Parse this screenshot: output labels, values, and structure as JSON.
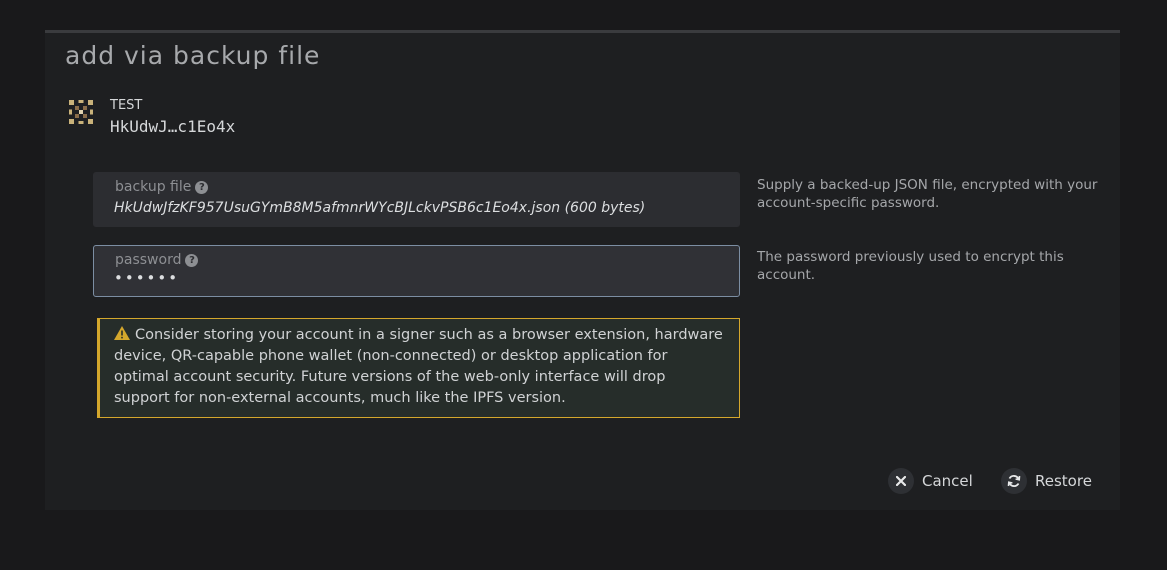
{
  "modal": {
    "title": "add via backup file"
  },
  "account": {
    "name": "TEST",
    "address": "HkUdwJ…c1Eo4x",
    "identicon": "identicon-icon"
  },
  "backup_file": {
    "label": "backup file",
    "value": "HkUdwJfzKF957UsuGYmB8M5afmnrWYcBJLckvPSB6c1Eo4x.json (600 bytes)",
    "help": "Supply a backed-up JSON file, encrypted with your account-specific password.",
    "help_icon": "question-circle-icon"
  },
  "password": {
    "label": "password",
    "value": "••••••",
    "help": "The password previously used to encrypt this account.",
    "help_icon": "question-circle-icon"
  },
  "warning": {
    "icon": "warning-triangle-icon",
    "text": "Consider storing your account in a signer such as a browser extension, hardware device, QR-capable phone wallet (non-connected) or desktop application for optimal account security. Future versions of the web-only interface will drop support for non-external accounts, much like the IPFS version.",
    "color": "#d4a72c"
  },
  "buttons": {
    "cancel_label": "Cancel",
    "cancel_icon": "close-icon",
    "restore_label": "Restore",
    "restore_icon": "sync-icon"
  }
}
